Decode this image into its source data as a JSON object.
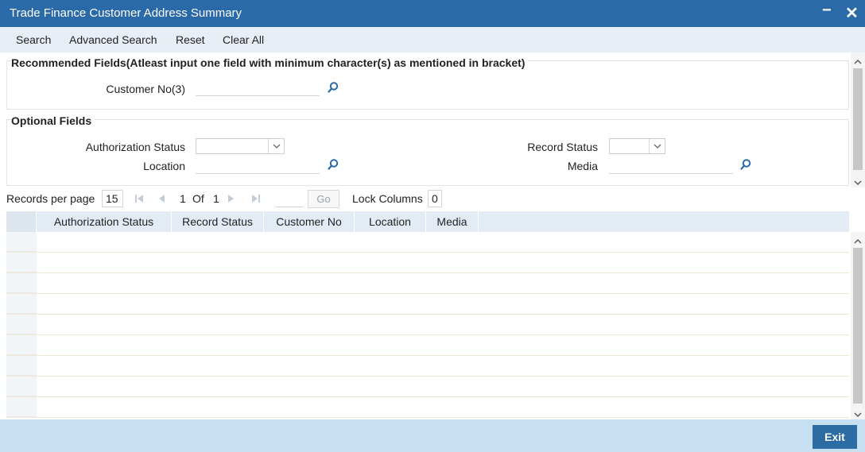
{
  "window": {
    "title": "Trade Finance Customer Address Summary",
    "minimize_label": "−",
    "close_label": "✕"
  },
  "toolbar": {
    "search": "Search",
    "advanced_search": "Advanced Search",
    "reset": "Reset",
    "clear_all": "Clear All"
  },
  "recommended": {
    "title": "Recommended Fields(Atleast input one field with minimum character(s) as mentioned in bracket)",
    "customer_no_label": "Customer No(3)",
    "customer_no_value": ""
  },
  "optional": {
    "title": "Optional Fields",
    "authorization_status_label": "Authorization Status",
    "authorization_status_value": "",
    "record_status_label": "Record Status",
    "record_status_value": "",
    "location_label": "Location",
    "location_value": "",
    "media_label": "Media",
    "media_value": ""
  },
  "pager": {
    "records_per_page_label": "Records per page",
    "records_per_page_value": "15",
    "current_page": "1",
    "of_label": "Of",
    "total_pages": "1",
    "go_label": "Go",
    "lock_columns_label": "Lock Columns",
    "lock_columns_value": "0"
  },
  "grid": {
    "columns": [
      "Authorization Status",
      "Record Status",
      "Customer No",
      "Location",
      "Media"
    ],
    "rows": []
  },
  "footer": {
    "exit_label": "Exit"
  },
  "colors": {
    "titlebar": "#2b6aa8",
    "toolbar": "#e8eef5",
    "footer": "#c6dff1",
    "exit_button": "#2d6ba3",
    "grid_header": "#e3ecf5"
  },
  "icons": {
    "lookup": "search-icon",
    "dropdown": "chevron-down-icon",
    "first": "first-page-icon",
    "prev": "previous-page-icon",
    "next": "next-page-icon",
    "last": "last-page-icon"
  }
}
